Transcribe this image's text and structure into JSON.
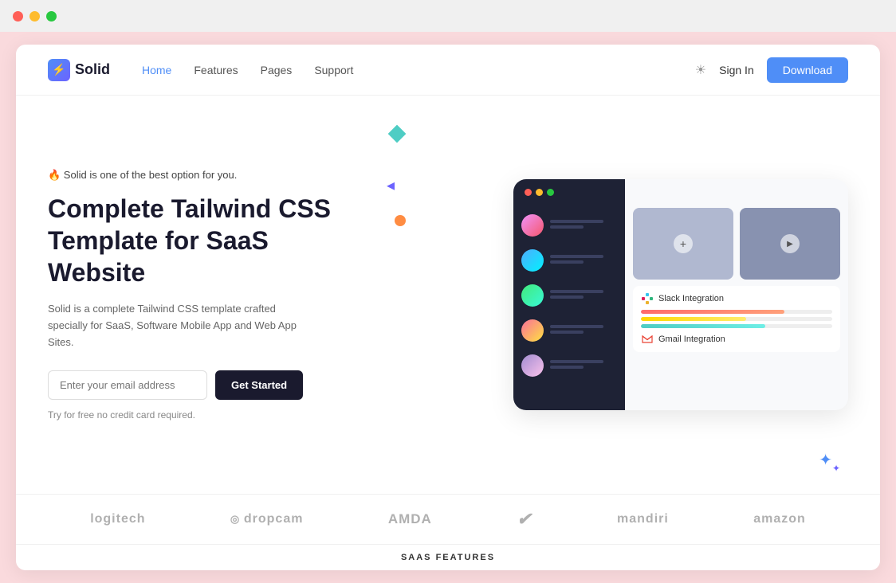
{
  "os_bar": {
    "traffic_lights": [
      "red",
      "yellow",
      "green"
    ]
  },
  "navbar": {
    "logo_text": "Solid",
    "links": [
      {
        "label": "Home",
        "active": true
      },
      {
        "label": "Features",
        "active": false
      },
      {
        "label": "Pages",
        "active": false
      },
      {
        "label": "Support",
        "active": false
      }
    ],
    "sign_in_label": "Sign In",
    "download_label": "Download"
  },
  "hero": {
    "tag": "🔥 Solid is one of the best option for you.",
    "title_line1": "Complete Tailwind CSS",
    "title_line2": "Template for SaaS Website",
    "description": "Solid is a complete Tailwind CSS template crafted specially for SaaS, Software Mobile App and Web App Sites.",
    "email_placeholder": "Enter your email address",
    "cta_label": "Get Started",
    "try_free_text": "Try for free no credit card required.",
    "integrations": {
      "slack_label": "Slack Integration",
      "gmail_label": "Gmail Integration"
    }
  },
  "brands": [
    {
      "label": "logitech"
    },
    {
      "label": "dropcam"
    },
    {
      "label": "AMDA"
    },
    {
      "label": "Nike"
    },
    {
      "label": "mandiri"
    },
    {
      "label": "amazon"
    }
  ],
  "footer": {
    "label": "SAAS FEATURES"
  }
}
